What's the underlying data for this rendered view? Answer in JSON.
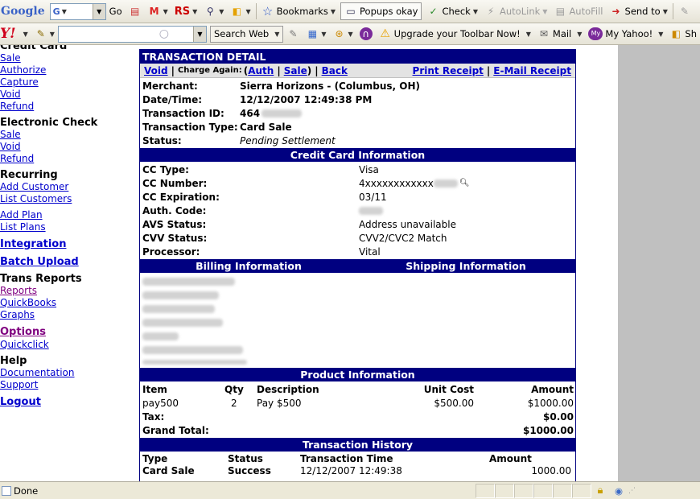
{
  "toolbar_google": {
    "logo": "Google",
    "go_label": "Go",
    "bookmarks_label": "Bookmarks",
    "popups_label": "Popups okay",
    "check_label": "Check",
    "autolink_label": "AutoLink",
    "autofill_label": "AutoFill",
    "sendto_label": "Send to"
  },
  "toolbar_yahoo": {
    "logo": "Y!",
    "search_web_label": "Search Web",
    "upgrade_label": "Upgrade your Toolbar Now!",
    "mail_label": "Mail",
    "myyahoo_label": "My Yahoo!",
    "shop_label": "Sh"
  },
  "nav": {
    "credit_card_header": "Credit Card",
    "cc_sale": "Sale",
    "cc_authorize": "Authorize",
    "cc_capture": "Capture",
    "cc_void": "Void",
    "cc_refund": "Refund",
    "echeck_header": "Electronic Check",
    "ec_sale": "Sale",
    "ec_void": "Void",
    "ec_refund": "Refund",
    "recurring_header": "Recurring",
    "add_customer": "Add Customer",
    "list_customers": "List Customers",
    "add_plan": "Add Plan",
    "list_plans": "List Plans",
    "integration": "Integration",
    "batch_upload": "Batch Upload",
    "trans_reports_header": "Trans Reports",
    "reports": "Reports",
    "quickbooks": "QuickBooks",
    "graphs": "Graphs",
    "options": "Options",
    "quickclick": "Quickclick",
    "help_header": "Help",
    "documentation": "Documentation",
    "support": "Support",
    "logout": "Logout"
  },
  "detail": {
    "title": "TRANSACTION DETAIL",
    "actions": {
      "void": "Void",
      "charge_again": "Charge Again:",
      "auth": "Auth",
      "sale": "Sale",
      "back": "Back",
      "print_receipt": "Print Receipt",
      "email_receipt": "E-Mail Receipt"
    },
    "merchant_label": "Merchant:",
    "merchant_value": "Sierra Horizons - (Columbus, OH)",
    "datetime_label": "Date/Time:",
    "datetime_value": "12/12/2007 12:49:38 PM",
    "txn_id_label": "Transaction ID:",
    "txn_id_value": "464",
    "txn_type_label": "Transaction Type:",
    "txn_type_value": "Card Sale",
    "status_label": "Status:",
    "status_value": "Pending Settlement"
  },
  "credit_card": {
    "header": "Credit Card Information",
    "cc_type_label": "CC Type:",
    "cc_type_value": "Visa",
    "cc_number_label": "CC Number:",
    "cc_number_value": "4xxxxxxxxxxxx",
    "cc_exp_label": "CC Expiration:",
    "cc_exp_value": "03/11",
    "auth_code_label": "Auth. Code:",
    "avs_label": "AVS Status:",
    "avs_value": "Address unavailable",
    "cvv_label": "CVV Status:",
    "cvv_value": "CVV2/CVC2 Match",
    "processor_label": "Processor:",
    "processor_value": "Vital"
  },
  "billing_header": "Billing Information",
  "shipping_header": "Shipping Information",
  "products": {
    "header": "Product Information",
    "columns": [
      "Item",
      "Qty",
      "Description",
      "Unit Cost",
      "Amount"
    ],
    "rows": [
      {
        "item": "pay500",
        "qty": "2",
        "description": "Pay $500",
        "unit_cost": "$500.00",
        "amount": "$1000.00"
      }
    ],
    "tax_label": "Tax:",
    "tax_value": "$0.00",
    "grand_total_label": "Grand Total:",
    "grand_total_value": "$1000.00"
  },
  "history": {
    "header": "Transaction History",
    "columns": [
      "Type",
      "Status",
      "Transaction Time",
      "Amount"
    ],
    "rows": [
      {
        "type": "Card Sale",
        "status": "Success",
        "time": "12/12/2007 12:49:38",
        "amount": "1000.00"
      }
    ]
  },
  "statusbar": {
    "text": "Done"
  },
  "colors": {
    "header_navy": "#000080",
    "link_blue": "#0000cc",
    "visited_purple": "#800080",
    "gutter_gray": "#c0c0c0"
  }
}
